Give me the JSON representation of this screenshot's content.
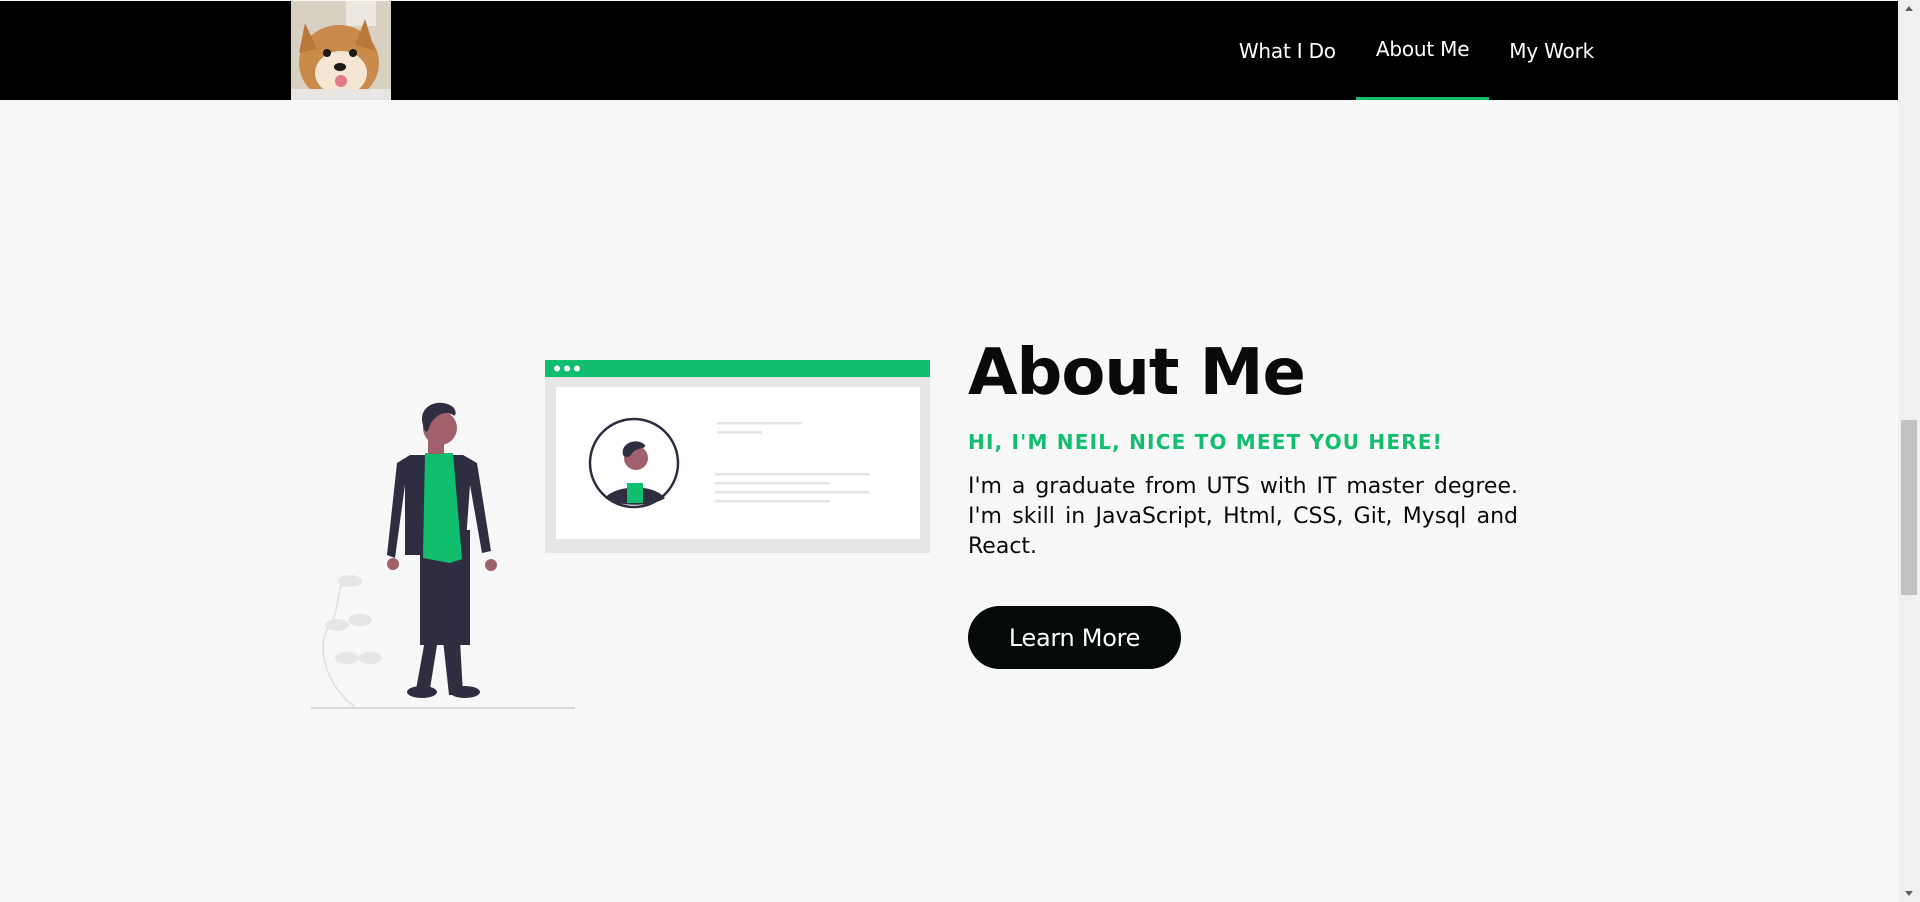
{
  "nav": {
    "logo_alt": "Shiba dog photo",
    "links": [
      {
        "label": "What I Do",
        "active": false
      },
      {
        "label": "About Me",
        "active": true
      },
      {
        "label": "My Work",
        "active": false
      }
    ],
    "active_color": "#10be6e"
  },
  "about": {
    "title": "About Me",
    "subtitle": "HI, I'M NEIL, NICE TO MEET YOU HERE!",
    "description": "I'm a graduate from UTS with IT master degree. I'm skill in JavaScript, Html, CSS, Git, Mysql and React.",
    "button_label": "Learn More"
  },
  "colors": {
    "accent": "#10be6e",
    "nav_bg": "#000000",
    "page_bg": "#f8f8f8",
    "button_bg": "#060909"
  }
}
